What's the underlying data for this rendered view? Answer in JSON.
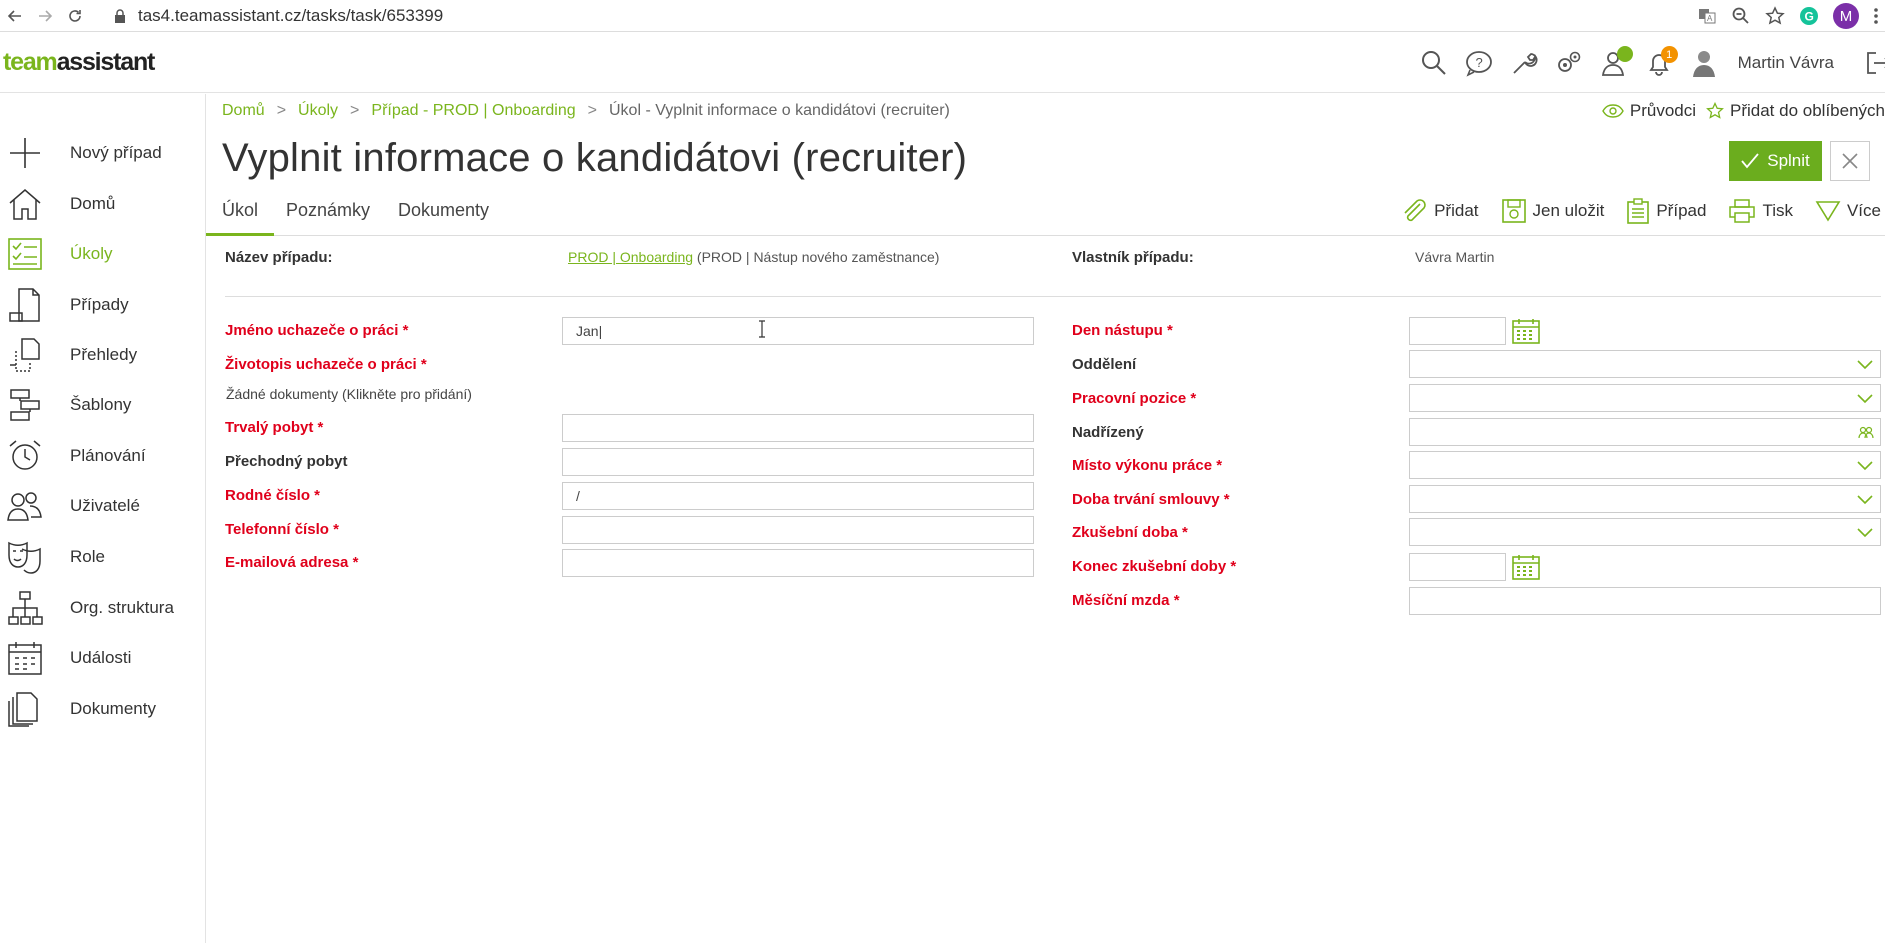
{
  "browser": {
    "url": "tas4.teamassistant.cz/tasks/task/653399",
    "profile_initial": "M"
  },
  "header": {
    "logo_team": "team",
    "logo_assistant": "assistant",
    "notification_count": "1",
    "user_name": "Martin Vávra"
  },
  "sidebar": {
    "items": [
      {
        "label": "Nový případ",
        "icon": "plus-icon"
      },
      {
        "label": "Domů",
        "icon": "home-icon"
      },
      {
        "label": "Úkoly",
        "icon": "tasks-icon",
        "active": true
      },
      {
        "label": "Případy",
        "icon": "cases-icon"
      },
      {
        "label": "Přehledy",
        "icon": "overviews-icon"
      },
      {
        "label": "Šablony",
        "icon": "templates-icon"
      },
      {
        "label": "Plánování",
        "icon": "alarm-clock-icon"
      },
      {
        "label": "Uživatelé",
        "icon": "users-icon"
      },
      {
        "label": "Role",
        "icon": "masks-icon"
      },
      {
        "label": "Org. struktura",
        "icon": "org-structure-icon"
      },
      {
        "label": "Události",
        "icon": "calendar-icon"
      },
      {
        "label": "Dokumenty",
        "icon": "documents-icon"
      }
    ]
  },
  "breadcrumb": {
    "items": [
      "Domů",
      "Úkoly",
      "Případ - PROD | Onboarding",
      "Úkol - Vyplnit informace o kandidátovi (recruiter)"
    ],
    "guide": "Průvodci",
    "favorite": "Přidat do oblíbených"
  },
  "page": {
    "title": "Vyplnit informace o kandidátovi (recruiter)",
    "complete_button": "Splnit"
  },
  "tabs": [
    "Úkol",
    "Poznámky",
    "Dokumenty"
  ],
  "toolbar": {
    "add": "Přidat",
    "save_only": "Jen uložit",
    "case": "Případ",
    "print": "Tisk",
    "more": "Více"
  },
  "case_info": {
    "case_name_label": "Název případu:",
    "case_name_link": "PROD | Onboarding",
    "case_name_suffix": "(PROD | Nástup nového zaměstnance)",
    "owner_label": "Vlastník případu:",
    "owner_value": "Vávra Martin"
  },
  "form_left": {
    "applicant_name_label": "Jméno uchazeče o práci *",
    "applicant_name_value": "Jan|",
    "cv_label": "Životopis uchazeče o práci *",
    "cv_value": "Žádné dokumenty (Klikněte pro přidání)",
    "permanent_residence_label": "Trvalý pobyt *",
    "temporary_residence_label": "Přechodný pobyt",
    "birth_number_label": "Rodné číslo *",
    "birth_number_value": "/",
    "phone_label": "Telefonní číslo *",
    "email_label": "E-mailová adresa *"
  },
  "form_right": {
    "start_date_label": "Den nástupu *",
    "department_label": "Oddělení",
    "position_label": "Pracovní pozice *",
    "supervisor_label": "Nadřízený",
    "workplace_label": "Místo výkonu práce *",
    "contract_duration_label": "Doba trvání smlouvy *",
    "probation_label": "Zkušební doba *",
    "probation_end_label": "Konec zkušební doby *",
    "salary_label": "Měsíční mzda *"
  },
  "colors": {
    "accent": "#7ab51d",
    "required": "#e0001b",
    "badge": "#f39200"
  }
}
